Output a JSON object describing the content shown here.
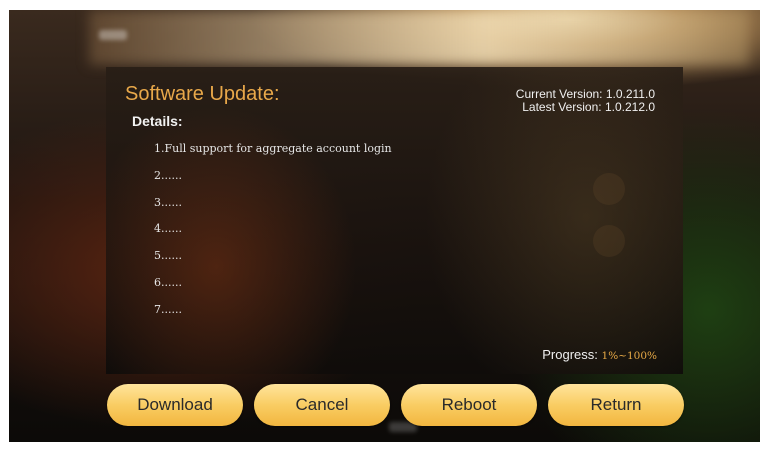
{
  "panel": {
    "title": "Software Update:",
    "details_label": "Details:",
    "current_version": "Current Version: 1.0.211.0",
    "latest_version": "Latest Version: 1.0.212.0",
    "details": [
      "1.Full support for aggregate account login",
      "2......",
      "3......",
      "4......",
      "5......",
      "6......",
      "7......"
    ],
    "progress_label": "Progress:",
    "progress_value": "1%~100%"
  },
  "buttons": {
    "download": "Download",
    "cancel": "Cancel",
    "reboot": "Reboot",
    "return": "Return"
  },
  "colors": {
    "title_orange": "#e8a84a",
    "button_yellow": "#f9cd63"
  }
}
